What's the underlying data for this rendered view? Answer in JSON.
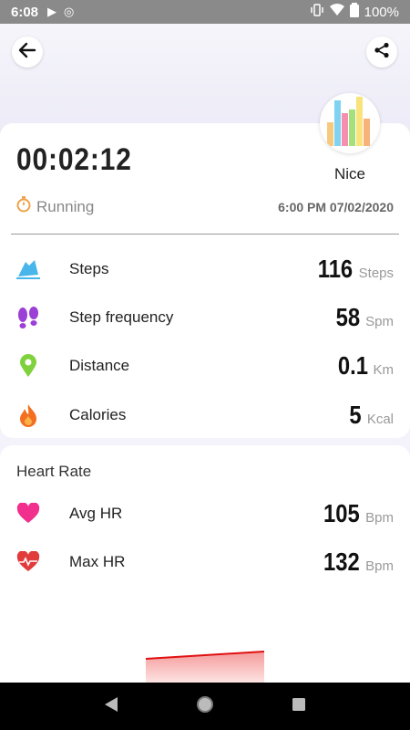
{
  "status_bar": {
    "time": "6:08",
    "battery": "100%"
  },
  "workout": {
    "duration": "00:02:12",
    "activity": "Running",
    "datetime": "6:00 PM 07/02/2020",
    "grade": "Nice"
  },
  "metrics": [
    {
      "label": "Steps",
      "value": "116",
      "unit": "Steps",
      "icon": "steps-icon"
    },
    {
      "label": "Step frequency",
      "value": "58",
      "unit": "Spm",
      "icon": "footprints-icon"
    },
    {
      "label": "Distance",
      "value": "0.1",
      "unit": "Km",
      "icon": "location-pin-icon"
    },
    {
      "label": "Calories",
      "value": "5",
      "unit": "Kcal",
      "icon": "flame-icon"
    }
  ],
  "heart_rate": {
    "title": "Heart Rate",
    "items": [
      {
        "label": "Avg HR",
        "value": "105",
        "unit": "Bpm",
        "icon": "heart-icon"
      },
      {
        "label": "Max HR",
        "value": "132",
        "unit": "Bpm",
        "icon": "heart-pulse-icon"
      }
    ]
  },
  "colors": {
    "accent_red": "#e23b3b",
    "card_bg": "#ffffff",
    "page_bg": "#f4f2fb"
  }
}
